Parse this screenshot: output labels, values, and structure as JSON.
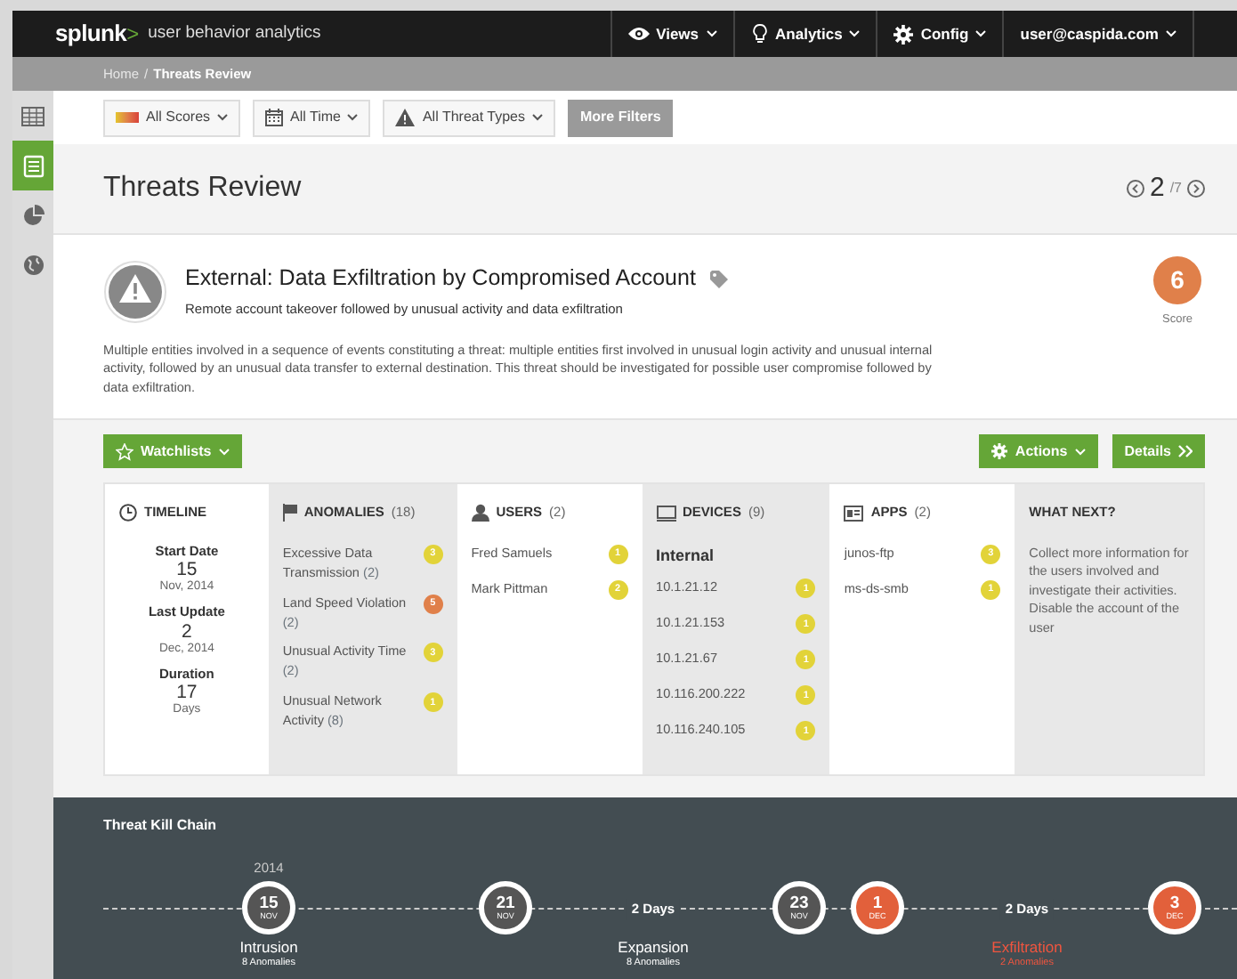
{
  "navbar": {
    "logo": "splunk",
    "logo_mark": ">",
    "product": "user behavior analytics",
    "menus": [
      {
        "label": "Views"
      },
      {
        "label": "Analytics"
      },
      {
        "label": "Config"
      },
      {
        "label": "user@caspida.com"
      }
    ]
  },
  "breadcrumb": {
    "items": [
      {
        "label": "Home",
        "active": false
      },
      {
        "label": "Threats Review",
        "active": true
      }
    ],
    "separator": "/"
  },
  "sidebar": {
    "items": [
      {
        "selected": false
      },
      {
        "selected": true
      },
      {
        "selected": false
      },
      {
        "selected": false
      }
    ]
  },
  "filters": [
    {
      "label": "All Scores"
    },
    {
      "label": "All Time"
    },
    {
      "label": "All Threat Types"
    }
  ],
  "more_filters": "More Filters",
  "page_title": "Threats Review",
  "pager": {
    "current": "2",
    "total": "/7"
  },
  "threat": {
    "title": "External: Data Exfiltration by Compromised Account",
    "subtitle": "Remote account takeover followed by unusual activity and data exfiltration",
    "description": "Multiple entities involved in a sequence of events constituting a threat: multiple entities first involved in unusual login activity and unusual internal activity, followed by an unusual data transfer to external destination. This threat should be investigated for possible user compromise followed by data exfiltration.",
    "score": "6",
    "score_label": "Score"
  },
  "buttons": {
    "watchlists": "Watchlists",
    "actions": "Actions",
    "details": "Details"
  },
  "timeline": {
    "title": "TIMELINE",
    "entries": [
      {
        "label": "Start Date",
        "value": "15",
        "sub": "Nov, 2014"
      },
      {
        "label": "Last Update",
        "value": "2",
        "sub": "Dec, 2014"
      },
      {
        "label": "Duration",
        "value": "17",
        "sub": "Days"
      }
    ]
  },
  "anomalies": {
    "title": "ANOMALIES",
    "count": "(18)",
    "items": [
      {
        "name": "Excessive Data Transmission",
        "count": "(2)",
        "badge": "3",
        "color": "#e2d339"
      },
      {
        "name": "Land Speed Violation",
        "count": "(2)",
        "badge": "5",
        "color": "#e0804a"
      },
      {
        "name": "Unusual Activity Time",
        "count": "(2)",
        "badge": "3",
        "color": "#e2d339"
      },
      {
        "name": "Unusual Network Activity",
        "count": "(8)",
        "badge": "1",
        "color": "#e2d339"
      }
    ]
  },
  "users": {
    "title": "USERS",
    "count": "(2)",
    "items": [
      {
        "name": "Fred Samuels",
        "badge": "1",
        "color": "#e2d339"
      },
      {
        "name": "Mark Pittman",
        "badge": "2",
        "color": "#e2d339"
      }
    ]
  },
  "devices": {
    "title": "DEVICES",
    "count": "(9)",
    "group": "Internal",
    "items": [
      {
        "name": "10.1.21.12",
        "badge": "1",
        "color": "#e2d339"
      },
      {
        "name": "10.1.21.153",
        "badge": "1",
        "color": "#e2d339"
      },
      {
        "name": "10.1.21.67",
        "badge": "1",
        "color": "#e2d339"
      },
      {
        "name": "10.116.200.222",
        "badge": "1",
        "color": "#e2d339"
      },
      {
        "name": "10.116.240.105",
        "badge": "1",
        "color": "#e2d339"
      }
    ]
  },
  "apps": {
    "title": "APPS",
    "count": "(2)",
    "items": [
      {
        "name": "junos-ftp",
        "badge": "3",
        "color": "#e2d339"
      },
      {
        "name": "ms-ds-smb",
        "badge": "1",
        "color": "#e2d339"
      }
    ]
  },
  "what_next": {
    "title": "WHAT NEXT?",
    "text": "Collect more information for the users involved and investigate their activities. Disable the account of the user"
  },
  "kill_chain": {
    "title": "Threat Kill Chain",
    "year": "2014",
    "events": [
      {
        "kind": "node",
        "day": "15",
        "month": "NOV",
        "alert": false
      },
      {
        "kind": "node",
        "day": "21",
        "month": "NOV",
        "alert": false
      },
      {
        "kind": "gap",
        "label": "2 Days"
      },
      {
        "kind": "node",
        "day": "23",
        "month": "NOV",
        "alert": false
      },
      {
        "kind": "node",
        "day": "1",
        "month": "DEC",
        "alert": true
      },
      {
        "kind": "gap",
        "label": "2 Days"
      },
      {
        "kind": "node",
        "day": "3",
        "month": "DEC",
        "alert": true
      }
    ],
    "phases": [
      {
        "name": "Intrusion",
        "anomalies": "8 Anomalies",
        "alert": false
      },
      {
        "name": "Expansion",
        "anomalies": "8 Anomalies",
        "alert": false
      },
      {
        "name": "Exfiltration",
        "anomalies": "2 Anomalies",
        "alert": true
      }
    ]
  }
}
